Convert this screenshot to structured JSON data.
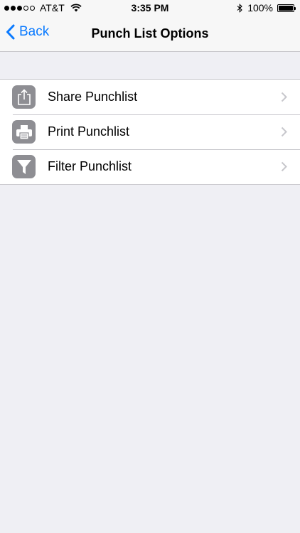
{
  "status_bar": {
    "carrier": "AT&T",
    "time": "3:35 PM",
    "battery": "100%",
    "battery_level": 1.0,
    "signal_bars": 3,
    "signal_total": 5
  },
  "nav": {
    "back_label": "Back",
    "title": "Punch List Options"
  },
  "options": [
    {
      "label": "Share Punchlist",
      "icon": "share-icon"
    },
    {
      "label": "Print Punchlist",
      "icon": "printer-icon"
    },
    {
      "label": "Filter Punchlist",
      "icon": "filter-icon"
    }
  ],
  "colors": {
    "accent": "#0a7aff",
    "icon_background": "#8e8e93",
    "page_background": "#efeff4"
  }
}
